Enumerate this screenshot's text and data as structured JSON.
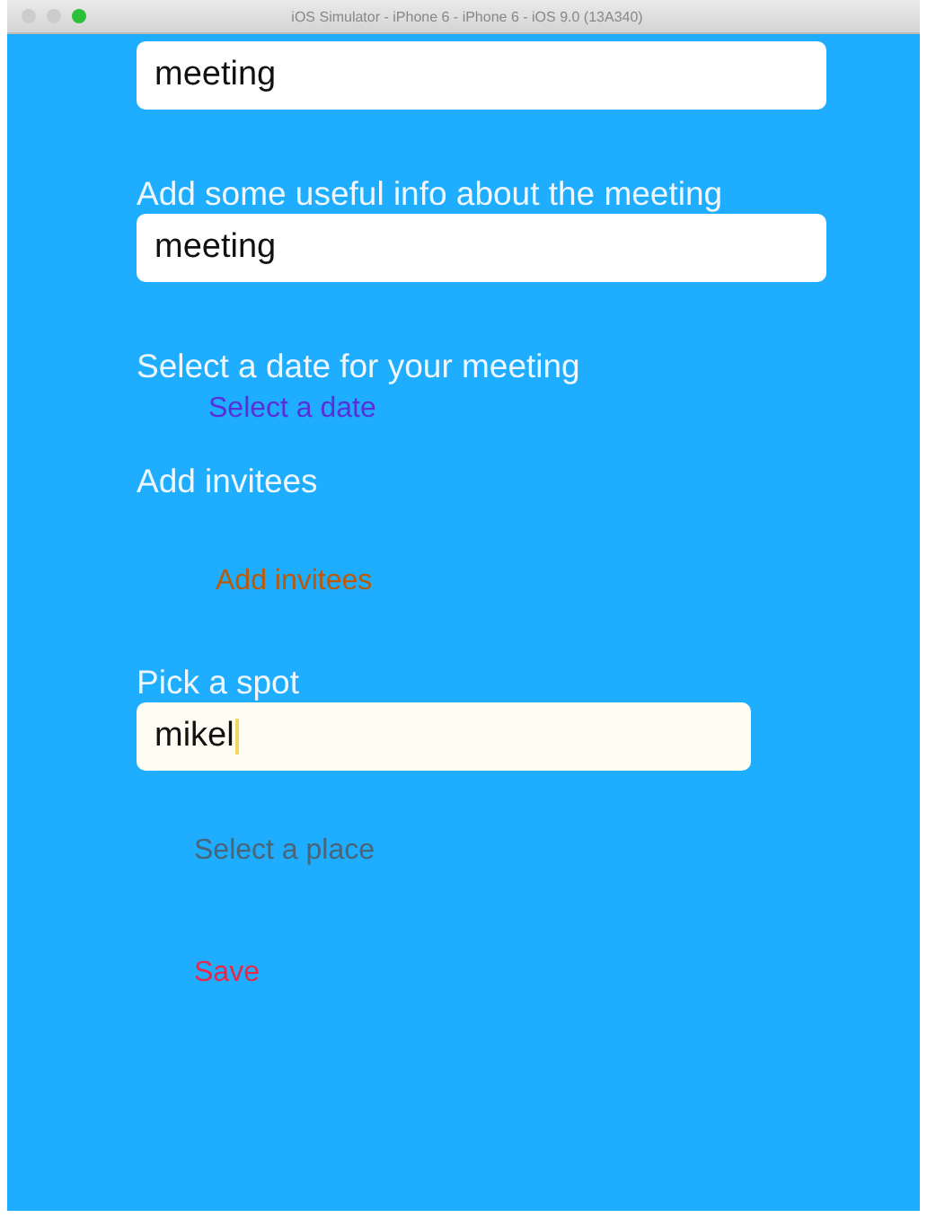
{
  "window": {
    "title": "iOS Simulator - iPhone 6 - iPhone 6 - iOS 9.0 (13A340)"
  },
  "items": [
    {
      "kind": "field",
      "value": "meeting",
      "focused": false
    },
    {
      "kind": "label",
      "text": "Add some useful info about the meeting"
    },
    {
      "kind": "field",
      "value": "meeting",
      "focused": false
    },
    {
      "kind": "label",
      "text": "Select a date for your meeting"
    },
    {
      "kind": "button",
      "text": "Select a date",
      "color": "#5a2fd8"
    },
    {
      "kind": "label",
      "text": "Add invitees"
    },
    {
      "kind": "button",
      "text": "Add invitees",
      "color": "#b85a08"
    },
    {
      "kind": "label",
      "text": "Pick a spot"
    },
    {
      "kind": "field",
      "value": "mikel",
      "focused": true
    },
    {
      "kind": "button",
      "text": "Select a place",
      "color": "#4a6478"
    },
    {
      "kind": "button",
      "text": "Save",
      "color": "#e8284a"
    }
  ]
}
